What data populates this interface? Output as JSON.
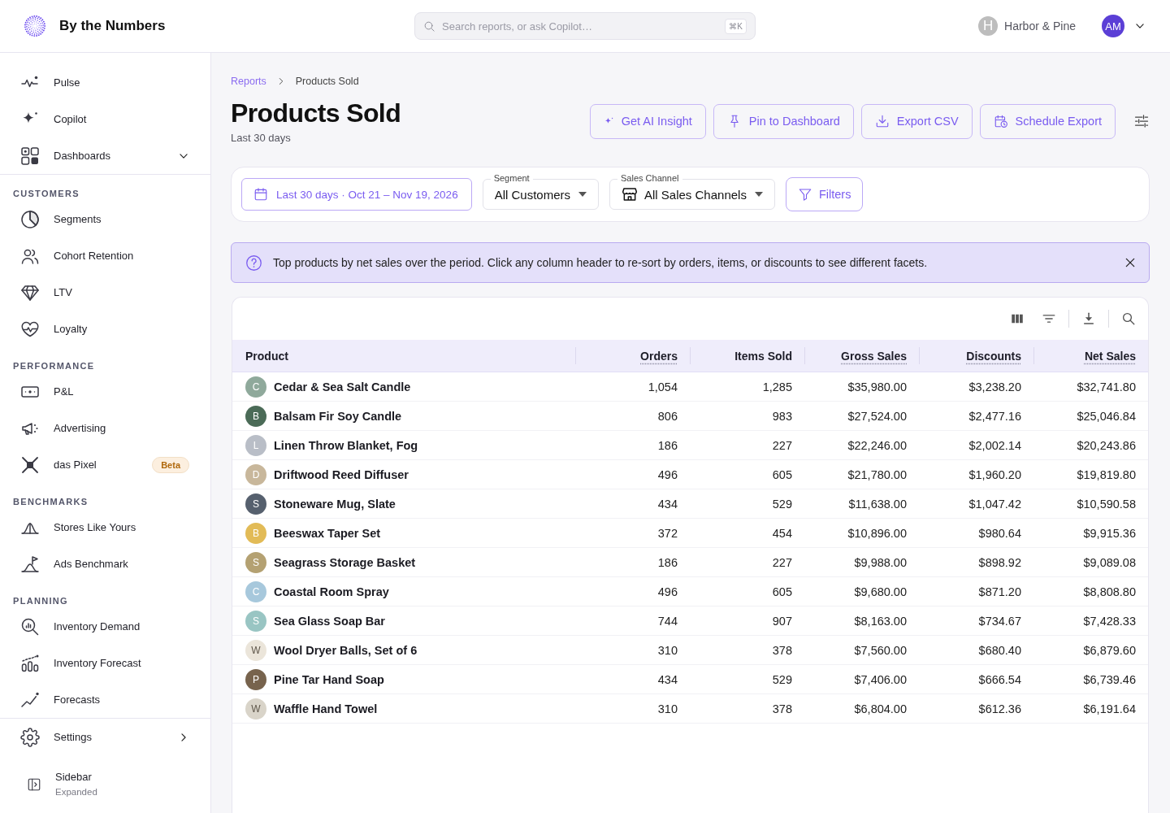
{
  "app": {
    "name": "By the Numbers"
  },
  "search": {
    "placeholder": "Search reports, or ask Copilot…",
    "shortcut": "⌘K"
  },
  "account": {
    "store_initial": "H",
    "store_name": "Harbor & Pine",
    "user_initials": "AM"
  },
  "sidebar": {
    "items": [
      {
        "label": "Pulse",
        "selected": false
      },
      {
        "label": "Copilot",
        "selected": false
      },
      {
        "label": "Dashboards",
        "selected": false,
        "expanded": false
      }
    ],
    "sections": [
      {
        "title": "CUSTOMERS",
        "items": [
          {
            "label": "Segments",
            "selected": false
          },
          {
            "label": "Cohort Retention",
            "selected": false
          },
          {
            "label": "LTV",
            "selected": false
          },
          {
            "label": "Loyalty",
            "selected": false
          }
        ]
      },
      {
        "title": "PERFORMANCE",
        "items": [
          {
            "label": "P&L",
            "selected": false
          },
          {
            "label": "Advertising",
            "selected": false
          },
          {
            "label": "das Pixel",
            "selected": false,
            "badge": "Beta"
          }
        ]
      },
      {
        "title": "BENCHMARKS",
        "items": [
          {
            "label": "Stores Like Yours",
            "selected": false
          },
          {
            "label": "Ads Benchmark",
            "selected": false
          }
        ]
      },
      {
        "title": "PLANNING",
        "items": [
          {
            "label": "Inventory Demand",
            "selected": false
          },
          {
            "label": "Inventory Forecast",
            "selected": false
          },
          {
            "label": "Forecasts",
            "selected": false
          }
        ]
      }
    ],
    "settings": {
      "label": "Settings"
    },
    "toggle": {
      "label": "Sidebar",
      "state": "Expanded"
    }
  },
  "breadcrumb": [
    {
      "label": "Reports"
    },
    {
      "label": "Products Sold"
    }
  ],
  "page": {
    "title": "Products Sold",
    "subtitle": "Last 30 days"
  },
  "actions": [
    "Get AI Insight",
    "Pin to Dashboard",
    "Export CSV",
    "Schedule Export"
  ],
  "filters": {
    "date_range": "Last 30 days · Oct 21 – Nov 19, 2026",
    "segment": {
      "label": "Segment",
      "value": "All Customers"
    },
    "sales_channel": {
      "label": "Sales Channel",
      "value": "All Sales Channels"
    },
    "button": "Filters"
  },
  "banner": {
    "text": "Top products by net sales over the period. Click any column header to re-sort by orders, items, or discounts to see different facets."
  },
  "table": {
    "columns": [
      {
        "label": "Product",
        "dotted_underline": false
      },
      {
        "label": "Orders",
        "dotted_underline": true
      },
      {
        "label": "Items Sold",
        "dotted_underline": false
      },
      {
        "label": "Gross Sales",
        "dotted_underline": true
      },
      {
        "label": "Discounts",
        "dotted_underline": true
      },
      {
        "label": "Net Sales",
        "dotted_underline": true
      }
    ],
    "rows": [
      {
        "initial": "C",
        "color": "#8fa99b",
        "cells": [
          "Cedar & Sea Salt Candle",
          "1,054",
          "1,285",
          "$35,980.00",
          "$3,238.20",
          "$32,741.80"
        ]
      },
      {
        "initial": "B",
        "color": "#4b6b57",
        "cells": [
          "Balsam Fir Soy Candle",
          "806",
          "983",
          "$27,524.00",
          "$2,477.16",
          "$25,046.84"
        ]
      },
      {
        "initial": "L",
        "color": "#b9bec7",
        "cells": [
          "Linen Throw Blanket, Fog",
          "186",
          "227",
          "$22,246.00",
          "$2,002.14",
          "$20,243.86"
        ]
      },
      {
        "initial": "D",
        "color": "#c8b79b",
        "cells": [
          "Driftwood Reed Diffuser",
          "496",
          "605",
          "$21,780.00",
          "$1,960.20",
          "$19,819.80"
        ]
      },
      {
        "initial": "S",
        "color": "#56606e",
        "cells": [
          "Stoneware Mug, Slate",
          "434",
          "529",
          "$11,638.00",
          "$1,047.42",
          "$10,590.58"
        ]
      },
      {
        "initial": "B",
        "color": "#e2bb57",
        "cells": [
          "Beeswax Taper Set",
          "372",
          "454",
          "$10,896.00",
          "$980.64",
          "$9,915.36"
        ]
      },
      {
        "initial": "S",
        "color": "#b4a172",
        "cells": [
          "Seagrass Storage Basket",
          "186",
          "227",
          "$9,988.00",
          "$898.92",
          "$9,089.08"
        ]
      },
      {
        "initial": "C",
        "color": "#a7c8dc",
        "cells": [
          "Coastal Room Spray",
          "496",
          "605",
          "$9,680.00",
          "$871.20",
          "$8,808.80"
        ]
      },
      {
        "initial": "S",
        "color": "#99c5c3",
        "cells": [
          "Sea Glass Soap Bar",
          "744",
          "907",
          "$8,163.00",
          "$734.67",
          "$7,428.33"
        ]
      },
      {
        "initial": "W",
        "color": "#ebe5da",
        "cells": [
          "Wool Dryer Balls, Set of 6",
          "310",
          "378",
          "$7,560.00",
          "$680.40",
          "$6,879.60"
        ]
      },
      {
        "initial": "P",
        "color": "#77634d",
        "cells": [
          "Pine Tar Hand Soap",
          "434",
          "529",
          "$7,406.00",
          "$666.54",
          "$6,739.46"
        ]
      },
      {
        "initial": "W",
        "color": "#d9d4c9",
        "cells": [
          "Waffle Hand Towel",
          "310",
          "378",
          "$6,804.00",
          "$612.36",
          "$6,191.64"
        ]
      }
    ]
  }
}
